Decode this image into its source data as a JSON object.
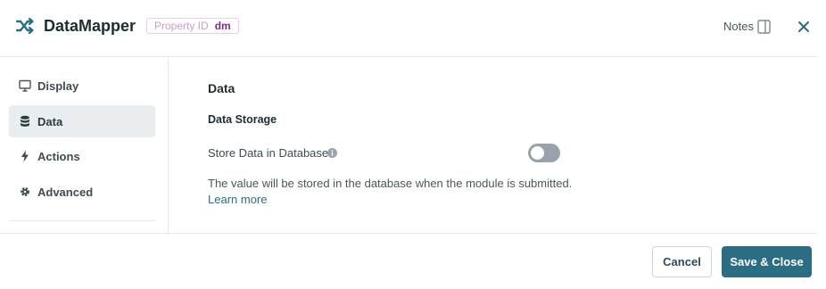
{
  "header": {
    "title": "DataMapper",
    "logo_icon": "shuffle-icon",
    "property_id_label": "Property ID",
    "property_id_value": "dm",
    "notes_label": "Notes",
    "notes_icon": "panel-toggle-icon",
    "close_icon": "close-icon"
  },
  "sidebar": {
    "items": [
      {
        "label": "Display",
        "icon": "monitor-icon",
        "active": false
      },
      {
        "label": "Data",
        "icon": "database-icon",
        "active": true
      },
      {
        "label": "Actions",
        "icon": "lightning-icon",
        "active": false
      },
      {
        "label": "Advanced",
        "icon": "gear-icon",
        "active": false
      }
    ]
  },
  "main": {
    "section_title": "Data",
    "group_title": "Data Storage",
    "store_label": "Store Data in Database",
    "store_enabled": false,
    "help_text": "The value will be stored in the database when the module is submitted.",
    "learn_more": "Learn more"
  },
  "footer": {
    "cancel_label": "Cancel",
    "save_label": "Save & Close"
  },
  "colors": {
    "accent": "#2b6d82",
    "active_nav_bg": "#e9edf0",
    "toggle_off": "#97a3ab",
    "badge_value": "#7b2f88"
  }
}
